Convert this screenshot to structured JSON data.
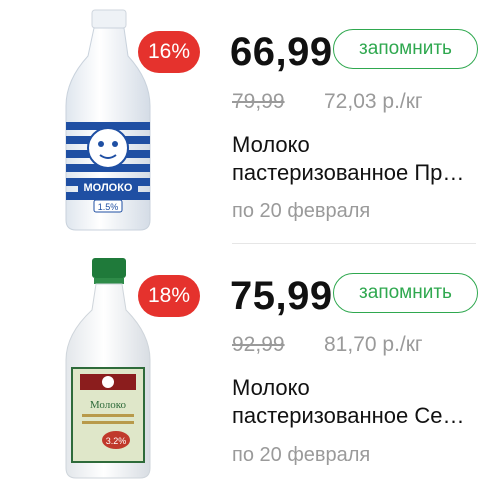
{
  "products": [
    {
      "discount": "16%",
      "price": "66,99",
      "remember_label": "запомнить",
      "old_price": "79,99",
      "unit_price": "72,03 р./кг",
      "name_line1": "Молоко",
      "name_line2": "пастеризованное Пр…",
      "valid_until": "по 20 февраля",
      "image_label": "МОЛОКО",
      "image_fat": "1.5%"
    },
    {
      "discount": "18%",
      "price": "75,99",
      "remember_label": "запомнить",
      "old_price": "92,99",
      "unit_price": "81,70 р./кг",
      "name_line1": "Молоко",
      "name_line2": "пастеризованное Се…",
      "valid_until": "по 20 февраля",
      "image_label": "Молоко",
      "image_fat": "3.2%"
    }
  ],
  "colors": {
    "badge": "#e5322d",
    "accent": "#2fa84f",
    "muted": "#9a9a9a"
  }
}
